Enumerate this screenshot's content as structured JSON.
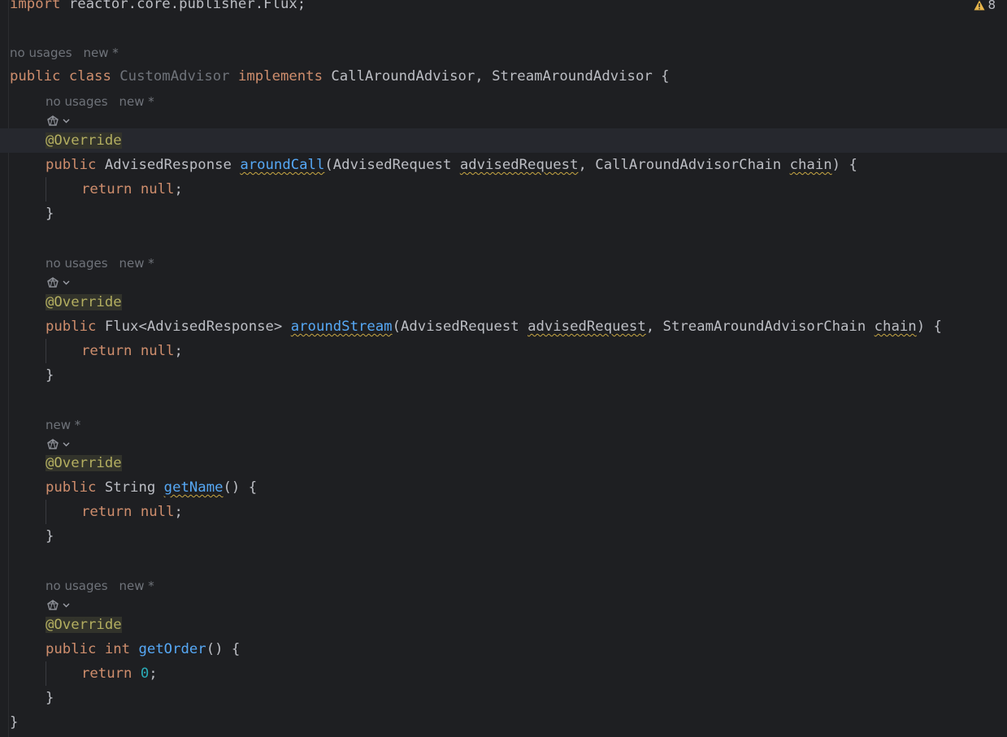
{
  "editor": {
    "warning_icon": "warning-triangle-icon",
    "warning_count": "8",
    "gem_icon": "ai-gem-icon",
    "chevron_icon": "chevron-down-icon",
    "lines": {
      "import_kw": "import",
      "import_path": " reactor.core.publisher.Flux;",
      "class_hint_usages": "no usages",
      "class_hint_new": "new *",
      "class_public": "public",
      "class_class": "class",
      "class_name": "CustomAdvisor",
      "class_implements": "implements",
      "class_interfaces": " CallAroundAdvisor, StreamAroundAdvisor {",
      "m1_hint_usages": "no usages",
      "m1_hint_new": "new *",
      "override": "@Override",
      "m1_public": "public",
      "m1_type": " AdvisedResponse ",
      "m1_name": "aroundCall",
      "m1_p_open": "(AdvisedRequest ",
      "m1_p1": "advisedRequest",
      "m1_p_mid": ", CallAroundAdvisorChain ",
      "m1_p2": "chain",
      "m1_p_close": ") {",
      "return_kw": "return",
      "null_kw": "null",
      "semicolon": ";",
      "close_brace": "}",
      "m2_hint_usages": "no usages",
      "m2_hint_new": "new *",
      "m2_public": "public",
      "m2_type": " Flux<AdvisedResponse> ",
      "m2_name": "aroundStream",
      "m2_p_open": "(AdvisedRequest ",
      "m2_p1": "advisedRequest",
      "m2_p_mid": ", StreamAroundAdvisorChain ",
      "m2_p2": "chain",
      "m2_p_close": ") {",
      "m3_hint_new": "new *",
      "m3_public": "public",
      "m3_type": " String ",
      "m3_name": "getName",
      "m3_tail": "() {",
      "m4_hint_usages": "no usages",
      "m4_hint_new": "new *",
      "m4_public": "public",
      "m4_int": "int",
      "m4_name": "getOrder",
      "m4_tail": "() {",
      "m4_return_value": "0"
    }
  }
}
